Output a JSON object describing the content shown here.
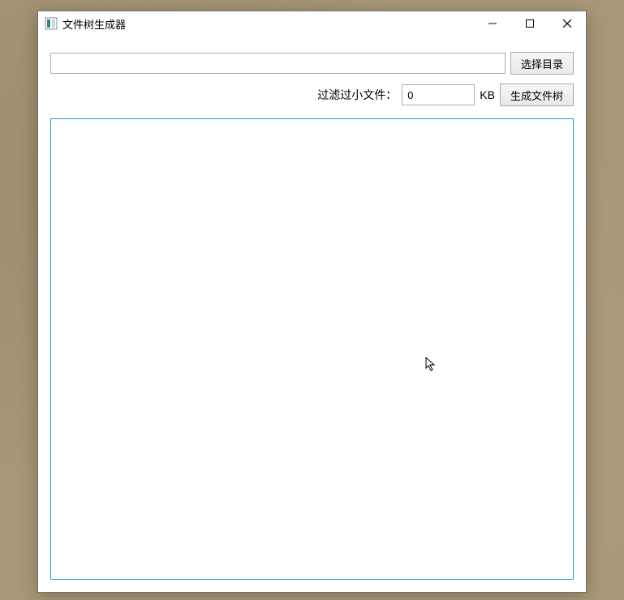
{
  "window": {
    "title": "文件树生成器"
  },
  "toolbar": {
    "path_value": "",
    "choose_dir_label": "选择目录"
  },
  "filter": {
    "label": "过滤过小文件：",
    "size_value": "0",
    "unit": "KB",
    "generate_label": "生成文件树"
  },
  "output": {
    "content": ""
  }
}
